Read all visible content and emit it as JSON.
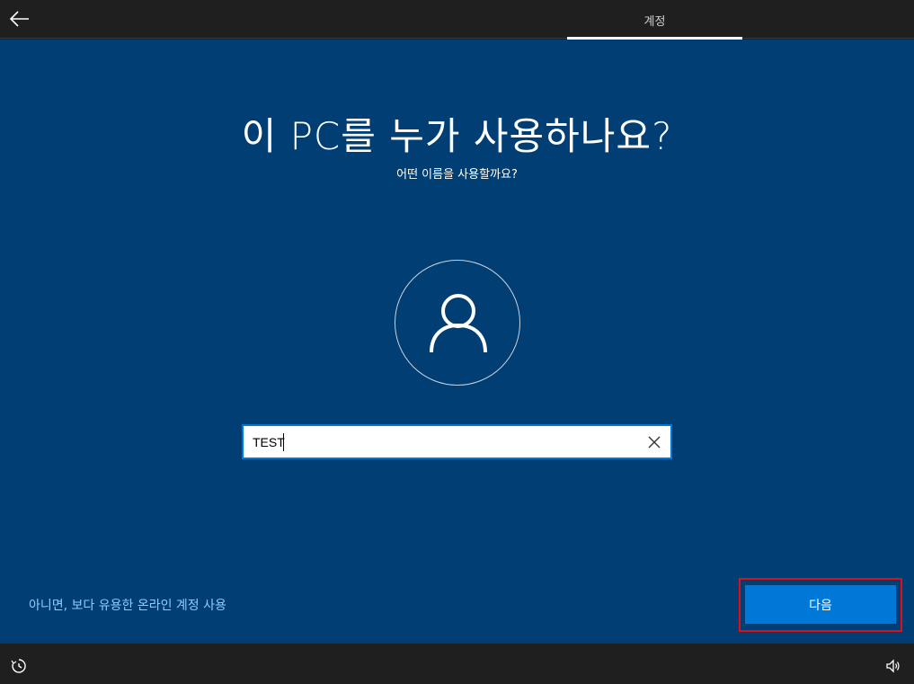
{
  "header": {
    "back_icon": "arrow-left-icon",
    "tab_label": "계정"
  },
  "main": {
    "title": "이 PC를 누가 사용하나요?",
    "subtitle": "어떤 이름을 사용할까요?",
    "avatar_icon": "person-icon",
    "name_input": {
      "value": "TEST",
      "clear_icon": "close-icon"
    },
    "alt_link": "아니면, 보다 유용한 온라인 계정 사용",
    "next_label": "다음"
  },
  "footer": {
    "ease_of_access_icon": "ease-of-access-icon",
    "volume_icon": "volume-icon"
  },
  "colors": {
    "background": "#003e73",
    "topbar": "#1f1f1f",
    "accent": "#0078d7",
    "link": "#8ecbff",
    "highlight": "#e0101a"
  }
}
